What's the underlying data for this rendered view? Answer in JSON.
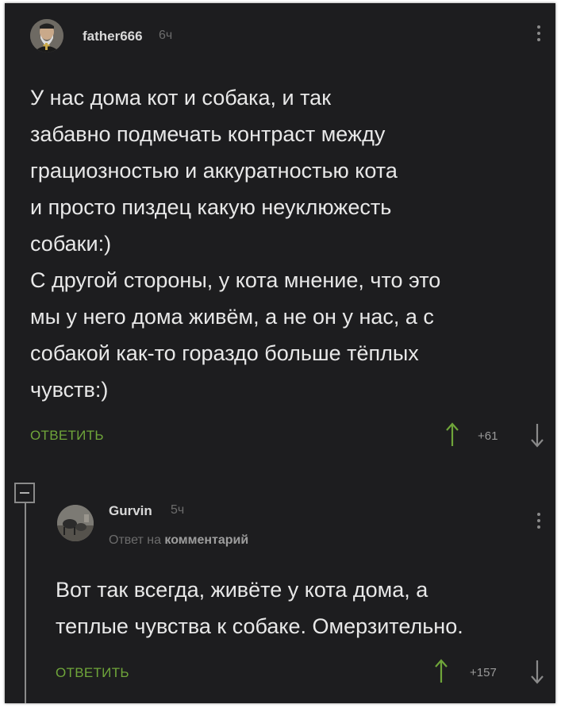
{
  "comment": {
    "username": "father666",
    "time": "6ч",
    "lines": [
      "У нас дома кот и собака, и так",
      "забавно подмечать контраст между",
      "грациозностью и аккуратностью кота",
      "и просто пиздец какую неуклюжесть",
      "собаки:)",
      "С другой стороны, у кота мнение, что это",
      "мы у него дома живём, а не он у нас, а с",
      "собакой как-то гораздо больше тёплых",
      "чувств:)"
    ],
    "reply_label": "ОТВЕТИТЬ",
    "rating": "+61"
  },
  "reply": {
    "username": "Gurvin",
    "time": "5ч",
    "reply_prefix": "Ответ на",
    "reply_target": "комментарий",
    "lines": [
      "Вот так всегда, живёте у кота дома, а",
      "теплые чувства к собаке. Омерзительно."
    ],
    "reply_label": "ОТВЕТИТЬ",
    "rating": "+157"
  },
  "colors": {
    "background": "#1d1d1f",
    "accent_green": "#6fa53a",
    "text": "#e8e8e8",
    "muted": "#6c6c6c"
  },
  "icons": [
    "avatar-priest",
    "avatar-photo",
    "more-menu-icon",
    "arrow-up-icon",
    "arrow-down-icon",
    "collapse-minus-icon"
  ]
}
